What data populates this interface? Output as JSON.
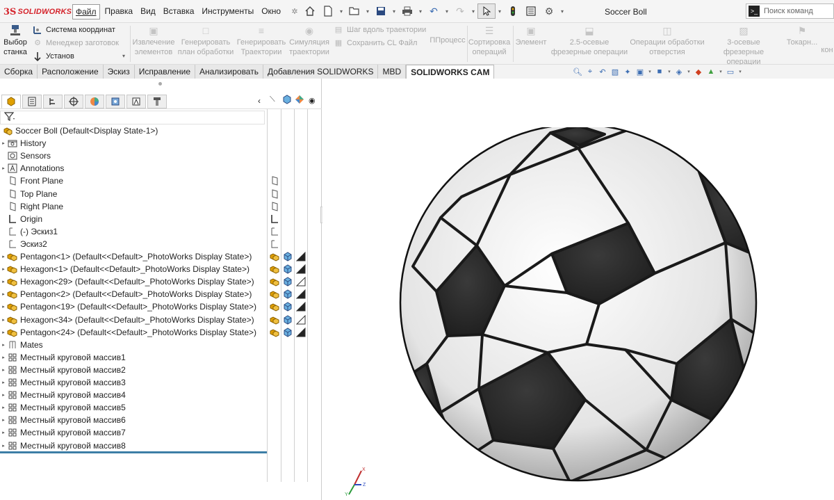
{
  "app": {
    "logo_ds": "3S",
    "logo_text": "SOLIDWORKS",
    "doc_title": "Soccer Boll",
    "search_placeholder": "Поиск команд",
    "search_prompt": ">_"
  },
  "menu": [
    "Файл",
    "Правка",
    "Вид",
    "Вставка",
    "Инструменты",
    "Окно"
  ],
  "quickbar_icons": [
    "pin-icon",
    "home-icon",
    "new-document-icon",
    "open-icon",
    "save-icon",
    "print-icon",
    "undo-icon",
    "redo-icon",
    "select-icon",
    "rebuild-icon",
    "file-properties-icon",
    "options-icon"
  ],
  "ribbon": {
    "machine_select": "Выбор станка",
    "coord_system": "Система координат",
    "stock_manager": "Менеджер заготовок",
    "setup": "Установ",
    "extract_features": "Извлечение элементов",
    "generate_plan": "Генерировать план обработки",
    "generate_toolpath": "Генерировать Траектории",
    "simulate_toolpath": "Симуляция траектории",
    "step_toolpath": "Шаг вдоль траектории",
    "save_cl": "Сохранить CL Файл",
    "post_process": "ППроцесс",
    "sort_operations": "Сортировка операций",
    "feature": "Элемент",
    "mill_25": "2.5-осевые фрезерные операции",
    "hole_ops": "Операции обработки отверстия",
    "mill_3": "3-осевые фрезерные операции",
    "turn": "Токарн...",
    "kon": "кон"
  },
  "tabs": [
    "Сборка",
    "Расположение",
    "Эскиз",
    "Исправление",
    "Анализировать",
    "Добавления SOLIDWORKS",
    "MBD",
    "SOLIDWORKS CAM"
  ],
  "tree": {
    "root": "Soccer Boll  (Default<Display State-1>)",
    "items": [
      {
        "label": "History",
        "icon": "history-icon",
        "expand": true
      },
      {
        "label": "Sensors",
        "icon": "sensors-icon",
        "expand": false
      },
      {
        "label": "Annotations",
        "icon": "annotations-icon",
        "expand": true
      },
      {
        "label": "Front Plane",
        "icon": "plane-icon",
        "expand": false
      },
      {
        "label": "Top Plane",
        "icon": "plane-icon",
        "expand": false
      },
      {
        "label": "Right Plane",
        "icon": "plane-icon",
        "expand": false
      },
      {
        "label": "Origin",
        "icon": "origin-icon",
        "expand": false
      },
      {
        "label": "(-) Эскиз1",
        "icon": "sketch-icon",
        "expand": false
      },
      {
        "label": "Эскиз2",
        "icon": "sketch-icon",
        "expand": false
      },
      {
        "label": "Pentagon<1> (Default<<Default>_PhotoWorks Display State>)",
        "icon": "part-icon",
        "expand": true
      },
      {
        "label": "Hexagon<1> (Default<<Default>_PhotoWorks Display State>)",
        "icon": "part-icon",
        "expand": true
      },
      {
        "label": "Hexagon<29> (Default<<Default>_PhotoWorks Display State>)",
        "icon": "part-icon",
        "expand": true
      },
      {
        "label": "Pentagon<2> (Default<<Default>_PhotoWorks Display State>)",
        "icon": "part-icon",
        "expand": true
      },
      {
        "label": "Pentagon<19> (Default<<Default>_PhotoWorks Display State>)",
        "icon": "part-icon",
        "expand": true
      },
      {
        "label": "Hexagon<34> (Default<<Default>_PhotoWorks Display State>)",
        "icon": "part-icon",
        "expand": true
      },
      {
        "label": "Pentagon<24> (Default<<Default>_PhotoWorks Display State>)",
        "icon": "part-icon",
        "expand": true
      },
      {
        "label": "Mates",
        "icon": "mates-icon",
        "expand": true
      },
      {
        "label": "Местный круговой массив1",
        "icon": "pattern-icon",
        "expand": true
      },
      {
        "label": "Местный круговой массив2",
        "icon": "pattern-icon",
        "expand": true
      },
      {
        "label": "Местный круговой массив3",
        "icon": "pattern-icon",
        "expand": true
      },
      {
        "label": "Местный круговой массив4",
        "icon": "pattern-icon",
        "expand": true
      },
      {
        "label": "Местный круговой массив5",
        "icon": "pattern-icon",
        "expand": true
      },
      {
        "label": "Местный круговой массив6",
        "icon": "pattern-icon",
        "expand": true
      },
      {
        "label": "Местный круговой массив7",
        "icon": "pattern-icon",
        "expand": true
      },
      {
        "label": "Местный круговой массив8",
        "icon": "pattern-icon",
        "expand": true
      }
    ]
  },
  "triad": {
    "x": "X",
    "y": "Y",
    "z": "Z"
  },
  "colors": {
    "accent": "#3d7ea6",
    "brand": "#d5232b",
    "ball_dark": "#2b2b2b",
    "ball_light": "#f2f2f2"
  }
}
